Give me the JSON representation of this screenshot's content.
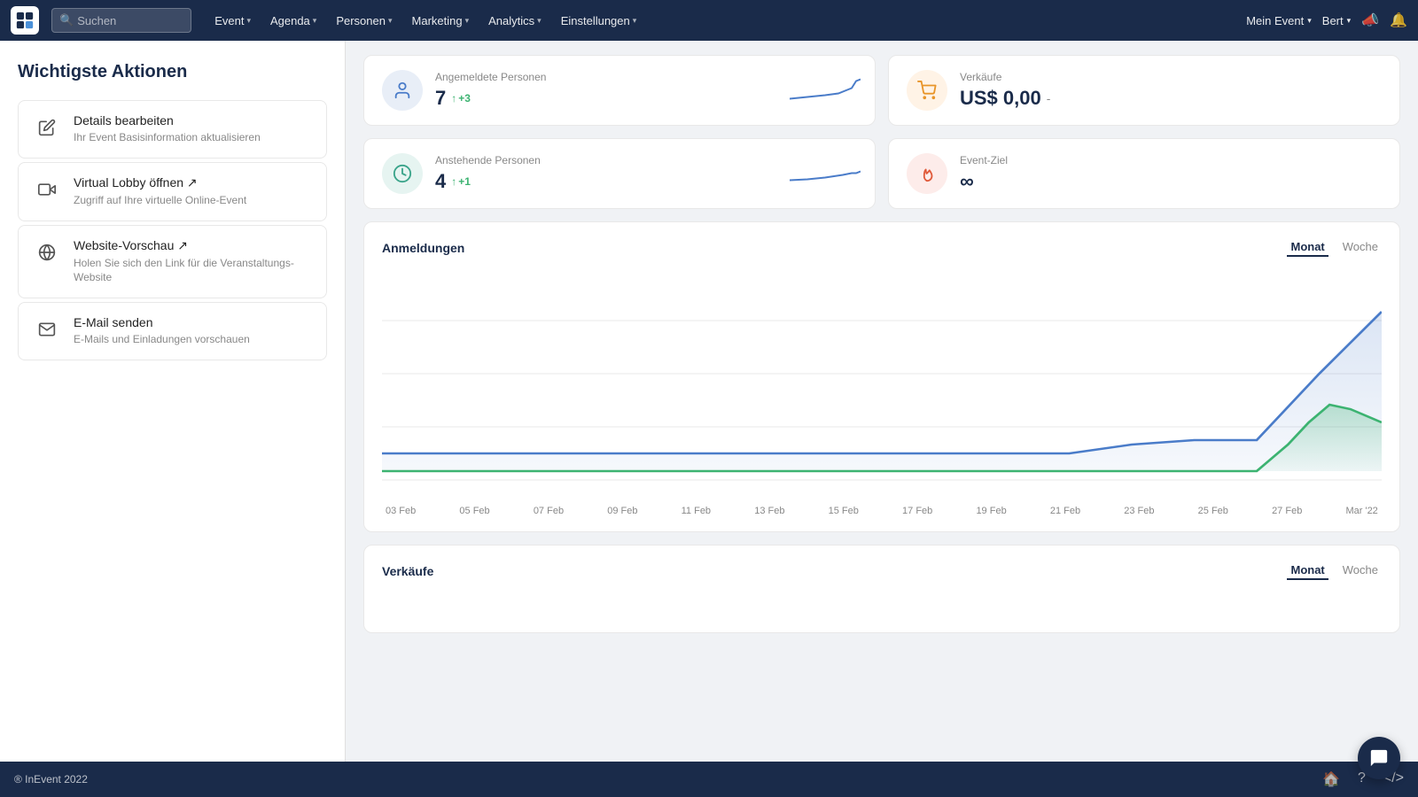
{
  "navbar": {
    "search_placeholder": "Suchen",
    "nav_items": [
      {
        "label": "Event",
        "has_chevron": true
      },
      {
        "label": "Agenda",
        "has_chevron": true
      },
      {
        "label": "Personen",
        "has_chevron": true
      },
      {
        "label": "Marketing",
        "has_chevron": true
      },
      {
        "label": "Analytics",
        "has_chevron": true
      },
      {
        "label": "Einstellungen",
        "has_chevron": true
      }
    ],
    "right_items": [
      {
        "label": "Mein Event",
        "has_chevron": true
      },
      {
        "label": "Bert",
        "has_chevron": true
      }
    ]
  },
  "sidebar": {
    "title": "Wichtigste Aktionen",
    "actions": [
      {
        "icon": "pencil",
        "title": "Details bearbeiten",
        "subtitle": "Ihr Event Basisinformation aktualisieren"
      },
      {
        "icon": "video",
        "title": "Virtual Lobby öffnen ↗",
        "subtitle": "Zugriff auf Ihre virtuelle Online-Event"
      },
      {
        "icon": "globe",
        "title": "Website-Vorschau ↗",
        "subtitle": "Holen Sie sich den Link für die Veranstaltungs-Website"
      },
      {
        "icon": "envelope",
        "title": "E-Mail senden",
        "subtitle": "E-Mails und Einladungen vorschauen"
      }
    ]
  },
  "stats": [
    {
      "label": "Angemeldete Personen",
      "value": "7",
      "delta": "+3",
      "icon_type": "person",
      "icon_color": "blue"
    },
    {
      "label": "Verkäufe",
      "value": "US$ 0,00",
      "delta": "-",
      "icon_type": "cart",
      "icon_color": "orange"
    },
    {
      "label": "Anstehende Personen",
      "value": "4",
      "delta": "+1",
      "icon_type": "clock",
      "icon_color": "teal"
    },
    {
      "label": "Event-Ziel",
      "value": "∞",
      "delta": "",
      "icon_type": "fire",
      "icon_color": "red"
    }
  ],
  "charts": [
    {
      "title": "Anmeldungen",
      "tabs": [
        "Monat",
        "Woche"
      ],
      "active_tab": "Monat",
      "x_labels": [
        "03 Feb",
        "05 Feb",
        "07 Feb",
        "09 Feb",
        "11 Feb",
        "13 Feb",
        "15 Feb",
        "17 Feb",
        "19 Feb",
        "21 Feb",
        "23 Feb",
        "25 Feb",
        "27 Feb",
        "Mar '22"
      ]
    },
    {
      "title": "Verkäufe",
      "tabs": [
        "Monat",
        "Woche"
      ],
      "active_tab": "Monat"
    }
  ],
  "footer": {
    "copyright": "® InEvent 2022"
  }
}
